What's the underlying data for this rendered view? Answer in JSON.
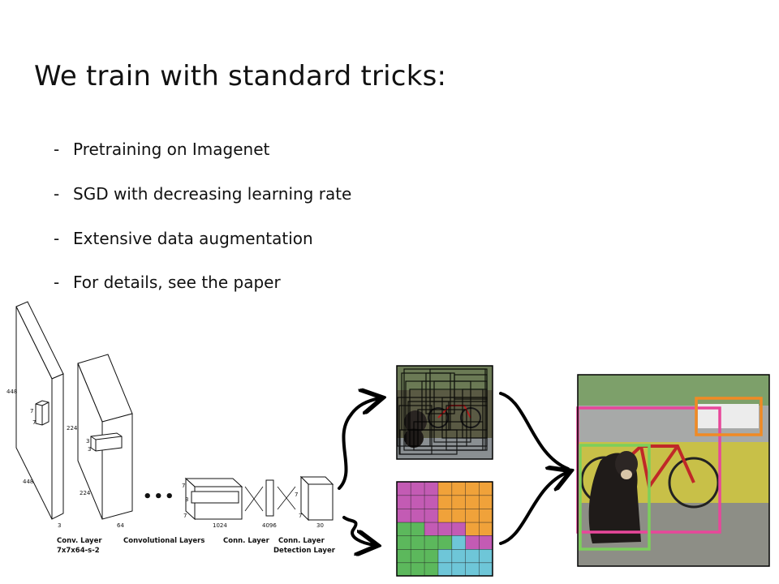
{
  "slide": {
    "title": "We train with standard tricks:",
    "bullet_marker": "-",
    "bullets": [
      "Pretraining on Imagenet",
      "SGD with decreasing learning rate",
      "Extensive data augmentation",
      "For details, see the paper"
    ]
  },
  "network": {
    "dims": {
      "in_h": "448",
      "in_w": "448",
      "in_c": "3",
      "in_k1": "7",
      "in_k2": "7",
      "l2_h": "224",
      "l2_w": "224",
      "l2_c": "64",
      "l2_k1": "3",
      "l2_k2": "3",
      "l3_a": "7",
      "l3_b": "3",
      "l3_c": "7",
      "l3_d": "1024",
      "fc": "4096",
      "out_a": "7",
      "out_b": "7",
      "out_c": "30"
    },
    "captions": {
      "conv1_a": "Conv. Layer",
      "conv1_b": "7x7x64-s-2",
      "conv_layers": "Convolutional Layers",
      "conn1": "Conn. Layer",
      "conn2_a": "Conn. Layer",
      "conn2_b": "Detection Layer"
    },
    "ellipsis": "•••"
  },
  "colors": {
    "box_pink": "#e8479a",
    "box_orange": "#f08a24",
    "box_green": "#7ccf5c",
    "grid_magenta": "#c35bb4",
    "grid_orange": "#f0a23a",
    "grid_green": "#5cb85c",
    "grid_cyan": "#6ec6d8"
  }
}
